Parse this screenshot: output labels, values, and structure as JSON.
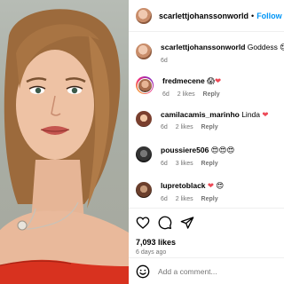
{
  "header": {
    "username": "scarlettjohanssonworld",
    "separator": "•",
    "follow_label": "Follow",
    "avatar_icon": "profile-avatar"
  },
  "caption": {
    "username": "scarlettjohanssonworld",
    "text": "Goddess",
    "emojis": "😍😍",
    "time": "6d"
  },
  "comments": [
    {
      "username": "fredmecene",
      "text": "",
      "emojis": "😱",
      "heart": "❤",
      "time": "6d",
      "likes": "2 likes",
      "reply": "Reply"
    },
    {
      "username": "camilacamis_marinho",
      "text": "Linda",
      "emojis": "",
      "heart": "❤",
      "time": "6d",
      "likes": "2 likes",
      "reply": "Reply"
    },
    {
      "username": "poussiere506",
      "text": "",
      "emojis": "😍😍😍",
      "heart": "",
      "time": "6d",
      "likes": "3 likes",
      "reply": "Reply"
    },
    {
      "username": "lupretoblack",
      "text": "",
      "emojis": "😍",
      "heart": "❤",
      "time": "6d",
      "likes": "2 likes",
      "reply": "Reply"
    }
  ],
  "actions": {
    "icons": [
      "heart-icon",
      "comment-icon",
      "share-icon"
    ],
    "likes_count": "7,093 likes",
    "posted_ago": "6 days ago"
  },
  "add_comment": {
    "placeholder": "Add a comment...",
    "icon": "emoji-icon"
  },
  "colors": {
    "follow_blue": "#0095f6",
    "heart_red": "#ed4956",
    "muted_text": "#737373",
    "dress_red": "#d8321f"
  }
}
